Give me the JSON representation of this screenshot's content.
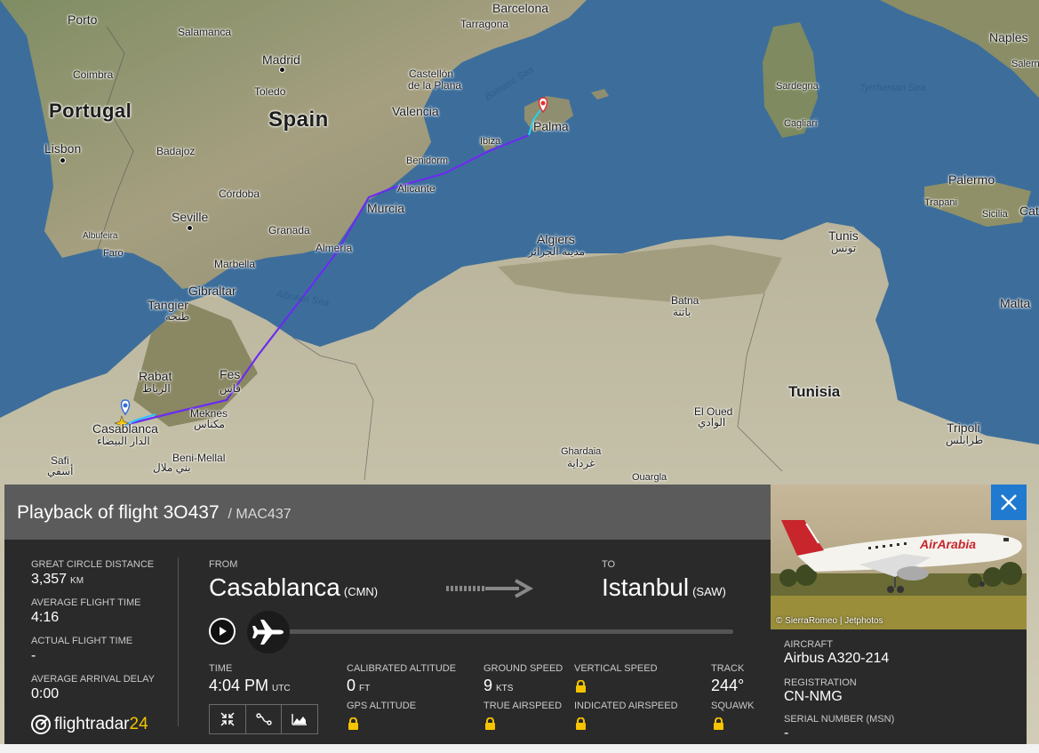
{
  "map": {
    "countries": {
      "portugal": "Portugal",
      "spain": "Spain",
      "tunisia": "Tunisia"
    },
    "cities": {
      "porto": "Porto",
      "salamanca": "Salamanca",
      "madrid": "Madrid",
      "coimbra": "Coimbra",
      "toledo": "Toledo",
      "lisbon": "Lisbon",
      "badajoz": "Badajoz",
      "cordoba": "Córdoba",
      "seville": "Seville",
      "albufeira": "Albufeira",
      "faro": "Faro",
      "granada": "Granada",
      "marbella": "Marbella",
      "gibraltar": "Gibraltar",
      "tangier": "Tangier",
      "tangier_ar": "طنجة",
      "rabat": "Rabat",
      "rabat_ar": "الرباط",
      "fes": "Fes",
      "fes_ar": "فاس",
      "meknes": "Meknes",
      "meknes_ar": "مكناس",
      "casablanca": "Casablanca",
      "casablanca_ar": "الدار البيضاء",
      "safi": "Safi",
      "safi_ar": "أسفي",
      "benimellal": "Beni-Mellal",
      "benimellal_ar": "بني ملال",
      "almeria": "Almería",
      "murcia": "Murcia",
      "alicante": "Alicante",
      "benidorm": "Benidorm",
      "valencia": "Valencia",
      "castellon": "Castellón",
      "castellon2": "de la Plana",
      "tarragona": "Tarragona",
      "barcelona": "Barcelona",
      "ibiza": "Ibiza",
      "palma": "Palma",
      "algiers": "Algiers",
      "algiers_ar": "مدينة الجزائر",
      "batna": "Batna",
      "batna_ar": "باتنة",
      "eloued": "El Oued",
      "eloued_ar": "الوادي",
      "ghardaia": "Ghardaia",
      "ghardaia_ar": "غرداية",
      "ouargla": "Ouargla",
      "tunis": "Tunis",
      "tunis_ar": "تونس",
      "tripoli": "Tripoli",
      "tripoli_ar": "طرابلس",
      "sardegna": "Sardegna",
      "cagliari": "Cagliari",
      "naples": "Naples",
      "salerno": "Salern",
      "palermo": "Palermo",
      "trapani": "Trapani",
      "sicilia": "Sicilia",
      "malta": "Malta",
      "cat": "Cat"
    },
    "seas": {
      "balearic": "Balearic Sea",
      "alboran": "Alboran Sea",
      "tyrrhenian": "Tyrrhenian Sea"
    }
  },
  "panel": {
    "title": "Playback of flight 3O437",
    "subtitle": "/ MAC437",
    "stats": [
      {
        "label": "GREAT CIRCLE DISTANCE",
        "value": "3,357",
        "unit": "KM"
      },
      {
        "label": "AVERAGE FLIGHT TIME",
        "value": "4:16",
        "unit": ""
      },
      {
        "label": "ACTUAL FLIGHT TIME",
        "value": "-",
        "unit": ""
      },
      {
        "label": "AVERAGE ARRIVAL DELAY",
        "value": "0:00",
        "unit": ""
      }
    ],
    "logo_text": "flightradar",
    "logo_num": "24",
    "from": {
      "label": "FROM",
      "city": "Casablanca",
      "code": "(CMN)"
    },
    "to": {
      "label": "TO",
      "city": "Istanbul",
      "code": "(SAW)"
    },
    "playback_progress": 0.0,
    "time": {
      "label": "TIME",
      "value": "4:04 PM",
      "unit": "UTC"
    },
    "calibrated_altitude": {
      "label": "CALIBRATED ALTITUDE",
      "value": "0",
      "unit": "FT"
    },
    "gps_altitude": {
      "label": "GPS ALTITUDE"
    },
    "ground_speed": {
      "label": "GROUND SPEED",
      "value": "9",
      "unit": "KTS"
    },
    "true_airspeed": {
      "label": "TRUE AIRSPEED"
    },
    "vertical_speed": {
      "label": "VERTICAL SPEED"
    },
    "indicated_airspeed": {
      "label": "INDICATED AIRSPEED"
    },
    "track": {
      "label": "TRACK",
      "value": "244°"
    },
    "squawk": {
      "label": "SQUAWK"
    }
  },
  "aircraft": {
    "photo_credit": "© SierraRomeo | Jetphotos",
    "livery_text": "AirArabia",
    "aircraft_label": "AIRCRAFT",
    "aircraft_value": "Airbus A320-214",
    "registration_label": "REGISTRATION",
    "registration_value": "CN-NMG",
    "serial_label": "SERIAL NUMBER (MSN)",
    "serial_value": "-"
  },
  "colors": {
    "sea": "#3b6f9e",
    "land": "#c9c3a9",
    "track": "#6a2cf0",
    "accent": "#1f7ad0",
    "panel": "#2a2a2a"
  }
}
